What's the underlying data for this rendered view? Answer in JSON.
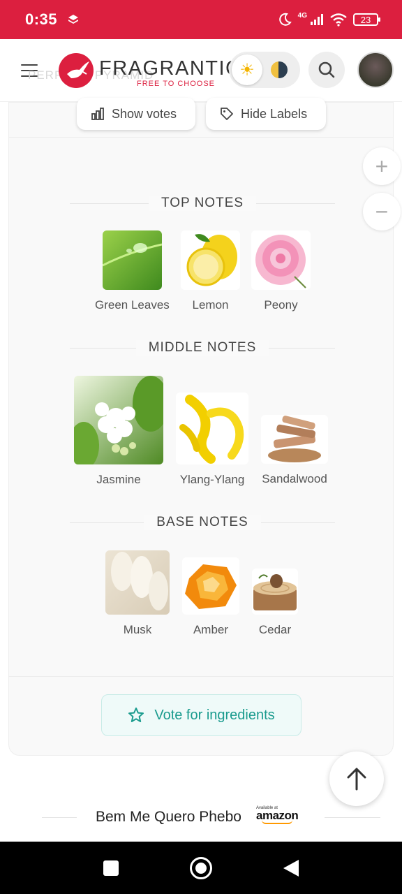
{
  "status_bar": {
    "time": "0:35",
    "network": "4G",
    "battery": "23"
  },
  "header": {
    "brand": "FRAGRANTICA",
    "tagline": "FREE TO CHOOSE",
    "ghost_text": "PERFUME PYRAMID"
  },
  "toolbar": {
    "show_votes": "Show votes",
    "hide_labels": "Hide Labels"
  },
  "zoom": {
    "in": "+",
    "out": "−"
  },
  "pyramid": {
    "top": {
      "title": "TOP NOTES",
      "notes": [
        {
          "name": "Green Leaves"
        },
        {
          "name": "Lemon"
        },
        {
          "name": "Peony"
        }
      ]
    },
    "middle": {
      "title": "MIDDLE NOTES",
      "notes": [
        {
          "name": "Jasmine"
        },
        {
          "name": "Ylang-Ylang"
        },
        {
          "name": "Sandalwood"
        }
      ]
    },
    "base": {
      "title": "BASE NOTES",
      "notes": [
        {
          "name": "Musk"
        },
        {
          "name": "Amber"
        },
        {
          "name": "Cedar"
        }
      ]
    }
  },
  "vote_button": "Vote for ingredients",
  "product": {
    "name": "Bem Me Quero Phebo"
  },
  "amazon_badge": {
    "small": "Available at",
    "big": "amazon"
  },
  "colors": {
    "brand_red": "#dc1f3f",
    "vote_teal": "#1a9b8e"
  }
}
